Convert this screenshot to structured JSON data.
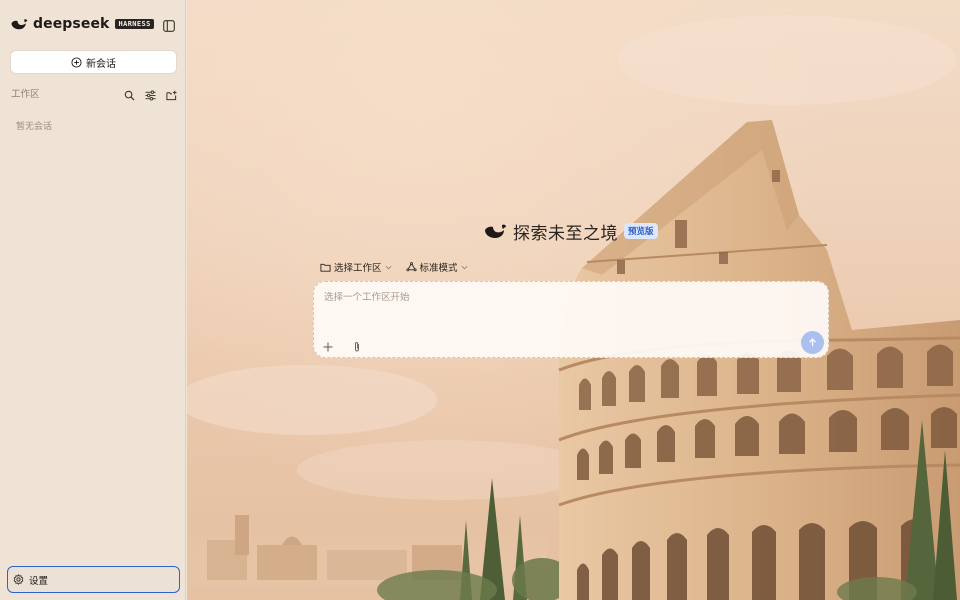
{
  "sidebar": {
    "brand": {
      "name": "deepseek",
      "badge": "HARNESS",
      "logo_icon": "whale-logo-icon"
    },
    "toggle_icon": "sidebar-toggle-icon",
    "new_chat_label": "新会话",
    "workspace_title": "工作区",
    "workspace_tools": [
      "search-icon",
      "filter-sliders-icon",
      "new-folder-icon"
    ],
    "empty_text": "暂无会话",
    "settings_label": "设置"
  },
  "main": {
    "hero_title": "探索未至之境",
    "hero_badge": "预览版",
    "toolbar": {
      "workspace_label": "选择工作区",
      "mode_label": "标准模式"
    },
    "composer": {
      "placeholder": "选择一个工作区开始",
      "value": ""
    }
  },
  "colors": {
    "accent": "#2f63c9",
    "badge_bg": "#dce7fb",
    "send_button": "#a9c0f0",
    "sidebar_bg": "#efe3d5"
  }
}
